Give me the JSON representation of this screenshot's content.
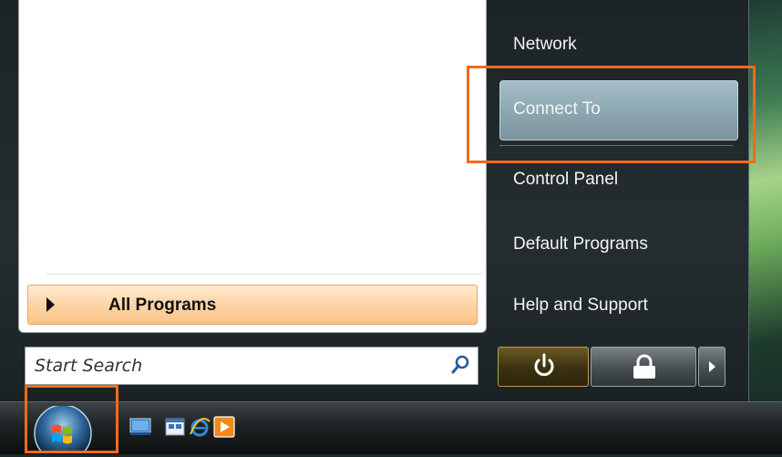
{
  "start_menu": {
    "left_panel": {
      "all_programs_label": "All Programs",
      "search_placeholder": "Start Search"
    },
    "right_panel": {
      "items": [
        {
          "label": "Network"
        },
        {
          "label": "Connect To",
          "highlighted": true
        },
        {
          "label": "Control Panel"
        },
        {
          "label": "Default Programs"
        },
        {
          "label": "Help and Support"
        }
      ]
    },
    "power_buttons": {
      "power_icon": "power-icon",
      "lock_icon": "lock-icon",
      "more_icon": "arrow-right-icon"
    }
  },
  "taskbar": {
    "quick_launch": [
      {
        "icon": "show-desktop-icon"
      },
      {
        "icon": "switch-windows-icon"
      },
      {
        "icon": "internet-explorer-icon"
      },
      {
        "icon": "media-player-icon"
      }
    ]
  },
  "colors": {
    "highlight_orange": "#f26a1b",
    "menu_dark": "#1d2426",
    "all_programs_bg": "#fdd3a4"
  }
}
